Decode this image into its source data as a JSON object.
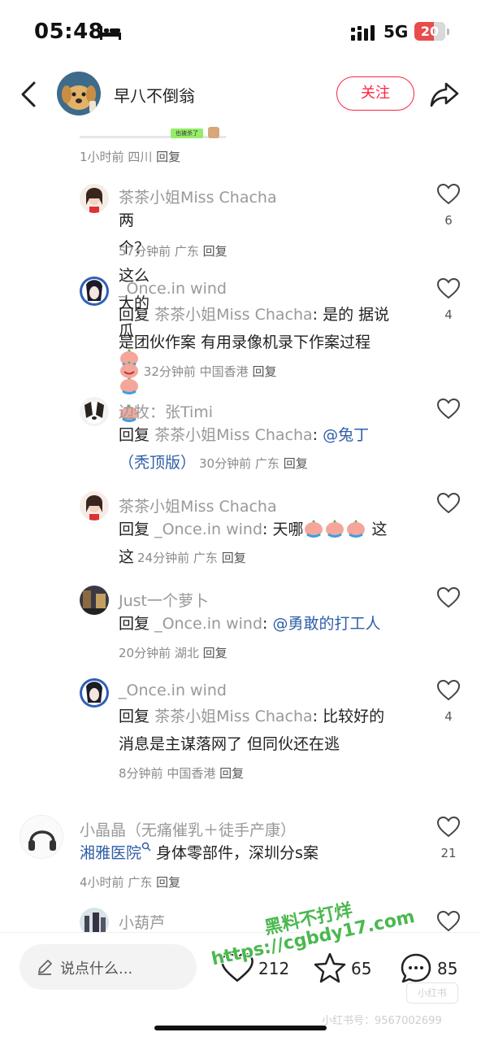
{
  "status_bar": {
    "time": "05:48",
    "network": "5G",
    "battery": "20"
  },
  "header": {
    "author_name": "早八不倒翁",
    "follow_label": "关注"
  },
  "image_strip": {
    "caption": "也被杀了"
  },
  "post_meta": {
    "time": "1小时前",
    "location": "四川",
    "reply": "回复"
  },
  "comments": [
    {
      "nickname": "茶茶小姐Miss Chacha",
      "text": "两个？这么大的瓜",
      "time": "57分钟前",
      "location": "广东",
      "reply": "回复",
      "likes": "6"
    },
    {
      "nickname": "_Once.in wind",
      "reply_prefix": "回复",
      "reply_to": "茶茶小姐Miss Chacha",
      "text_line1": ": 是的 据说",
      "text_line2": "是团伙作案 有用录像机录下作案过程",
      "time": "32分钟前",
      "location": "中国香港",
      "reply": "回复",
      "likes": "4"
    },
    {
      "nickname": "边牧：张Timi",
      "reply_prefix": "回复",
      "reply_to": "茶茶小姐Miss Chacha",
      "colon": ": ",
      "mention_part1": "@兔丁",
      "mention_part2": "（秃顶版）",
      "time": "30分钟前",
      "location": "广东",
      "reply": "回复",
      "likes": ""
    },
    {
      "nickname": "茶茶小姐Miss Chacha",
      "reply_prefix": "回复",
      "reply_to": "_Once.in wind",
      "text_line1": ": 天哪",
      "text_end": " 这",
      "text_line2": "这",
      "time": "24分钟前",
      "location": "广东",
      "reply": "回复",
      "likes": ""
    },
    {
      "nickname": "Just一个萝卜",
      "reply_prefix": "回复",
      "reply_to": "_Once.in wind",
      "colon": ": ",
      "mention": "@勇敢的打工人",
      "time": "20分钟前",
      "location": "湖北",
      "reply": "回复",
      "likes": ""
    },
    {
      "nickname": "_Once.in wind",
      "reply_prefix": "回复",
      "reply_to": "茶茶小姐Miss Chacha",
      "text_line1": ": 比较好的",
      "text_line2": "消息是主谋落网了 但同伙还在逃",
      "time": "8分钟前",
      "location": "中国香港",
      "reply": "回复",
      "likes": "4"
    },
    {
      "nickname": "小晶晶（无痛催乳＋徒手产康）",
      "link_text": "湘雅医院",
      "text": " 身体零部件，深圳分s案",
      "time": "4小时前",
      "location": "广东",
      "reply": "回复",
      "likes": "21"
    },
    {
      "nickname": "小葫芦",
      "likes": ""
    }
  ],
  "bottom_bar": {
    "input_placeholder": "说点什么...",
    "like_count": "212",
    "collect_count": "65",
    "comment_count": "85"
  },
  "watermark": {
    "line1": "黑料不打烊",
    "line2": "https://cgbdy17.com",
    "xhs_id": "小红书号：9567002699",
    "xhs_logo": "小红书"
  },
  "colors": {
    "accent": "#ff2442",
    "link": "#2f5ea8",
    "watermark": "#4bb84f"
  }
}
